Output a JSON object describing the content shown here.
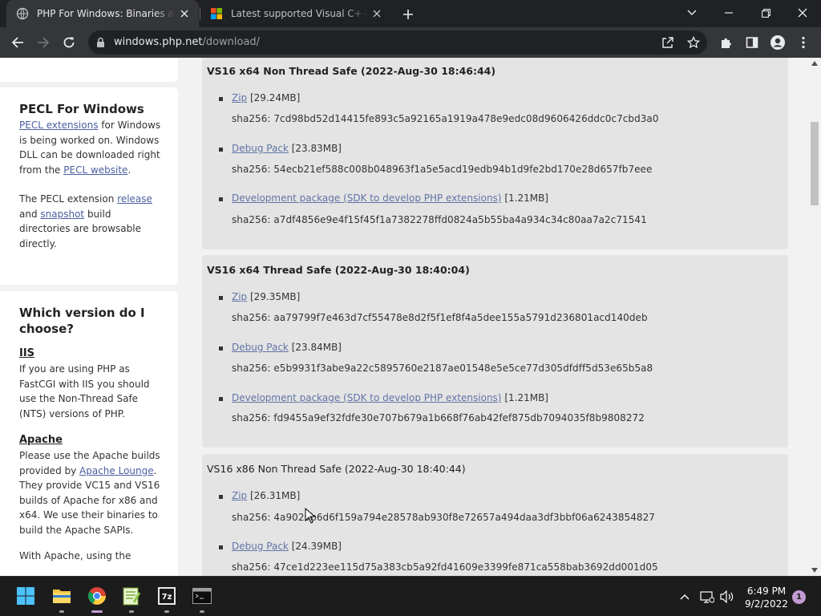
{
  "browser": {
    "tabs": [
      {
        "title": "PHP For Windows: Binaries and sources Releases",
        "active": true
      },
      {
        "title": "Latest supported Visual C++ Redistributable downloads",
        "active": false
      }
    ],
    "url_host": "windows.php.net",
    "url_path": "/download/"
  },
  "sidebar": {
    "pecl": {
      "heading": "PECL For Windows",
      "link_extensions": "PECL extensions",
      "text1": " for Windows is being worked on. Windows DLL can be downloaded right from the ",
      "link_website": "PECL website",
      "text2": ".",
      "text3": "The PECL extension ",
      "link_release": "release",
      "text4": " and ",
      "link_snapshot": "snapshot",
      "text5": " build directories are browsable directly."
    },
    "which": {
      "heading": "Which version do I choose?",
      "iis_heading": "IIS",
      "iis_text": "If you are using PHP as FastCGI with IIS you should use the Non-Thread Safe (NTS) versions of PHP.",
      "apache_heading": "Apache",
      "apache_text1": "Please use the Apache builds provided by ",
      "apache_link": "Apache Lounge",
      "apache_text2": ". They provide VC15 and VS16 builds of Apache for x86 and x64. We use their binaries to build the Apache SAPIs.",
      "apache_text3": "With Apache, using the"
    }
  },
  "releases": [
    {
      "title": "VS16 x64 Non Thread Safe (2022-Aug-30 18:46:44)",
      "items": [
        {
          "link": "Zip",
          "size": " [29.24MB]",
          "sha": "sha256: 7cd98bd52d14415fe893c5a92165a1919a478e9edc08d9606426ddc0c7cbd3a0"
        },
        {
          "link": "Debug Pack",
          "size": " [23.83MB]",
          "sha": "sha256: 54ecb21ef588c008b048963f1a5e5acd19edb94b1d9fe2bd170e28d657fb7eee"
        },
        {
          "link": "Development package (SDK to develop PHP extensions)",
          "size": " [1.21MB]",
          "sha": "sha256: a7df4856e9e4f15f45f1a7382278ffd0824a5b55ba4a934c34c80aa7a2c71541"
        }
      ]
    },
    {
      "title": "VS16 x64 Thread Safe (2022-Aug-30 18:40:04)",
      "items": [
        {
          "link": "Zip",
          "size": " [29.35MB]",
          "sha": "sha256: aa79799f7e463d7cf55478e8d2f5f1ef8f4a5dee155a5791d236801acd140deb"
        },
        {
          "link": "Debug Pack",
          "size": " [23.84MB]",
          "sha": "sha256: e5b9931f3abe9a22c5895760e2187ae01548e5e5ce77d305dfdff5d53e65b5a8"
        },
        {
          "link": "Development package (SDK to develop PHP extensions)",
          "size": " [1.21MB]",
          "sha": "sha256: fd9455a9ef32fdfe30e707b679a1b668f76ab42fef875db7094035f8b9808272"
        }
      ]
    },
    {
      "title": "VS16 x86 Non Thread Safe (2022-Aug-30 18:40:44)",
      "items": [
        {
          "link": "Zip",
          "size": " [26.31MB]",
          "sha": "sha256: 4a9029b6d6f159a794e28578ab930f8e72657a494daa3df3bbf06a6243854827"
        },
        {
          "link": "Debug Pack",
          "size": " [24.39MB]",
          "sha": "sha256: 47ce1d223ee115d75a383cb5a92fd41609e3399fe871ca558bab3692dd001d05"
        }
      ]
    }
  ],
  "taskbar": {
    "time": "6:49 PM",
    "date": "9/2/2022",
    "notifications": "1"
  }
}
